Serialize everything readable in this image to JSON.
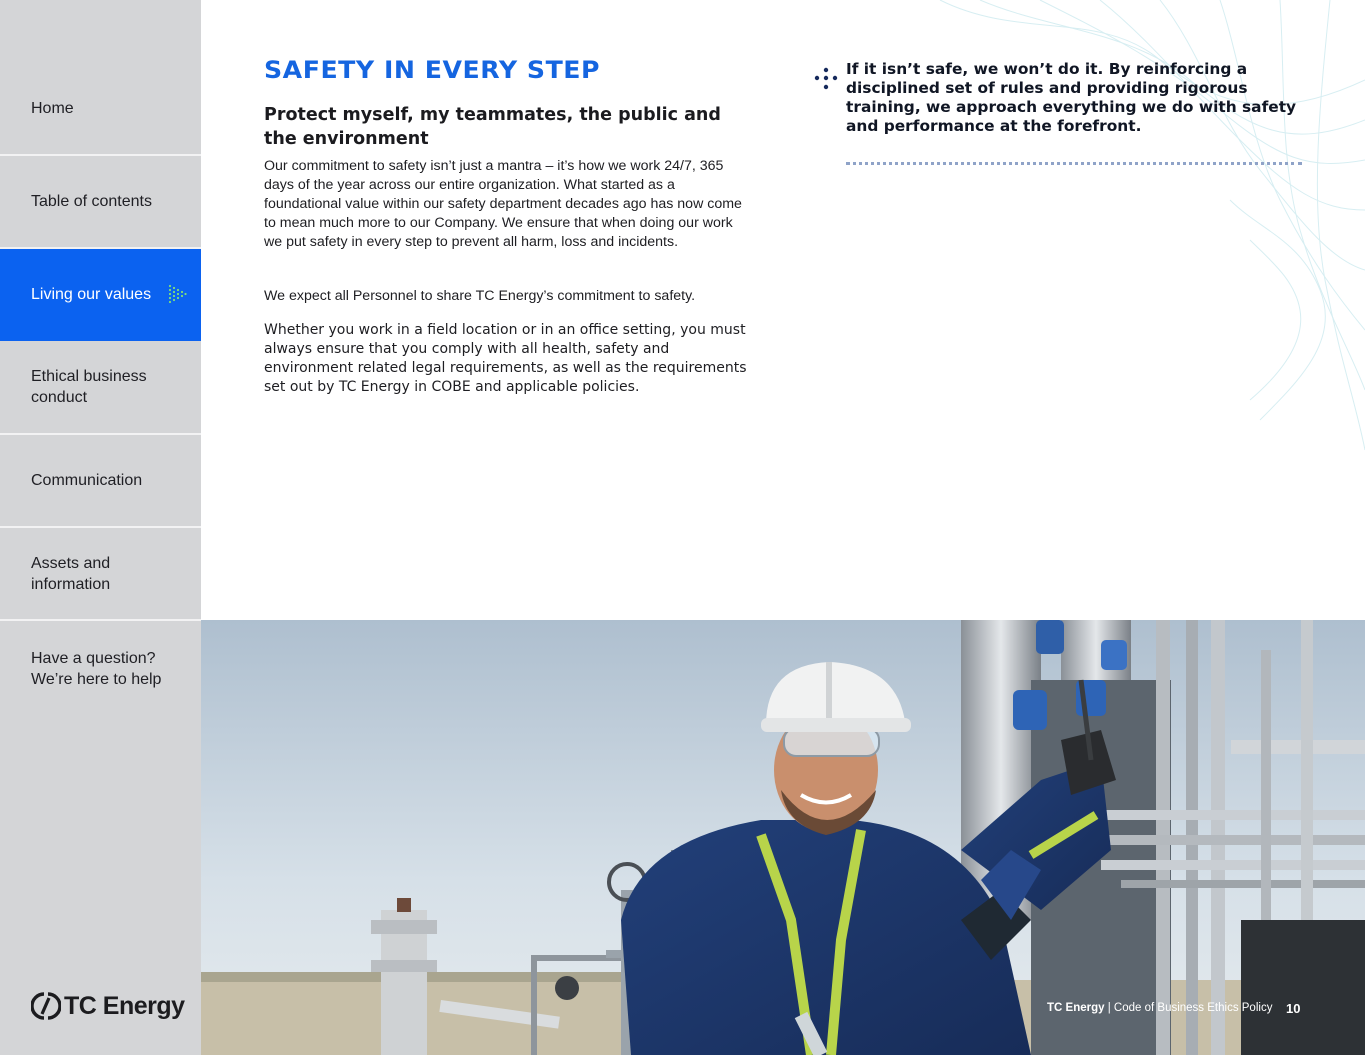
{
  "sidebar": {
    "items": [
      {
        "label": "Home"
      },
      {
        "label": "Table of contents"
      },
      {
        "label": "Living our values"
      },
      {
        "label": "Ethical business conduct"
      },
      {
        "label": "Communication"
      },
      {
        "label": "Assets and information"
      },
      {
        "label": "Have a question? We’re here to help"
      }
    ],
    "active_index": 2,
    "logo_text": "TC Energy"
  },
  "main": {
    "title": "SAFETY IN EVERY STEP",
    "subtitle": "Protect myself, my teammates, the public and the environment",
    "paragraphs": [
      "Our commitment to safety isn’t just a mantra – it’s how we work 24/7, 365 days of the year across our entire organization. What started as a foundational value within our safety department decades ago has now come to mean much more to our Company. We ensure that when doing our work we put safety in every step to prevent all harm, loss and incidents.",
      "We expect all Personnel to share TC Energy’s commitment to safety.",
      "Whether you work in a field location or in an office setting, you must always ensure that you comply with all health, safety and environment related legal requirements, as well as the requirements set out by TC Energy in COBE and applicable policies."
    ]
  },
  "callout": {
    "text": "If it isn’t safe, we won’t do it. By reinforcing a disciplined set of rules and providing rigorous training, we approach everything we do with safety and performance at the forefront."
  },
  "footer": {
    "brand": "TC Energy",
    "separator": "|",
    "doc_title": "Code of Business Ethics Policy",
    "page_number": "10"
  },
  "colors": {
    "accent": "#0b62f0",
    "title_blue": "#1565e0",
    "sidebar_bg": "#d4d5d7"
  },
  "icons": {
    "active_nav": "dotted-arrow-icon",
    "callout": "dot-cluster-icon",
    "logo": "tc-energy-logo-icon"
  }
}
